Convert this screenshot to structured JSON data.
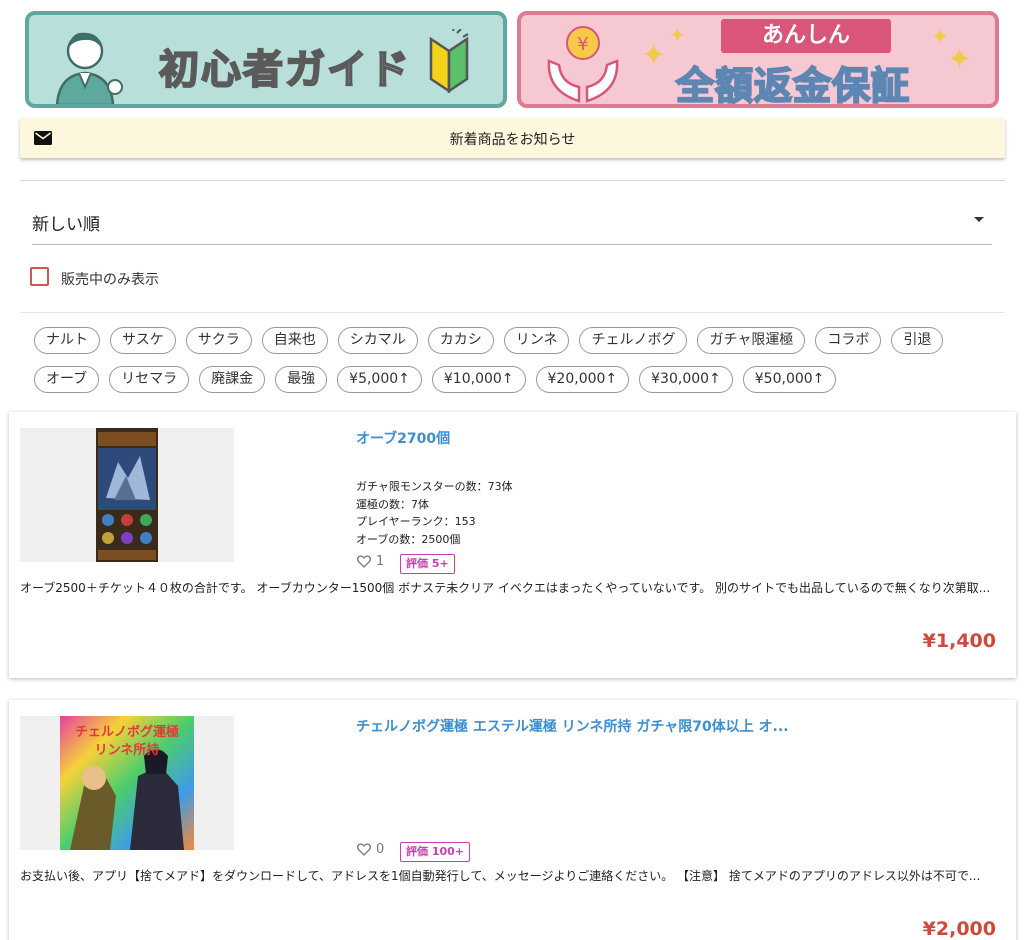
{
  "banners": {
    "guide": {
      "text": "初心者ガイド",
      "bg": "#b9dfdb",
      "border": "#5fa89d"
    },
    "refund": {
      "ribbon": "あんしん",
      "text": "全額返金保証",
      "bg": "#f6c9d2",
      "border": "#e07a93"
    }
  },
  "notify": {
    "icon": "mail-icon",
    "label": "新着商品をお知らせ"
  },
  "sort": {
    "selected": "新しい順"
  },
  "filter": {
    "on_sale_only_label": "販売中のみ表示",
    "checked": false
  },
  "tags": {
    "row1": [
      "ナルト",
      "サスケ",
      "サクラ",
      "自来也",
      "シカマル",
      "カカシ",
      "リンネ",
      "チェルノボグ",
      "ガチャ限運極",
      "コラボ",
      "引退"
    ],
    "row2": [
      "オーブ",
      "リセマラ",
      "廃課金",
      "最強",
      "¥5,000↑",
      "¥10,000↑",
      "¥20,000↑",
      "¥30,000↑",
      "¥50,000↑"
    ]
  },
  "products": [
    {
      "title": "オーブ2700個",
      "specs": [
        "ガチャ限モンスターの数：73体",
        "運極の数：7体",
        "プレイヤーランク：153",
        "オーブの数：2500個"
      ],
      "likes": "1",
      "rating": "評価 5+",
      "description": "オーブ2500＋チケット４０枚の合計です。 オーブカウンター1500個 ボナステ未クリア イベクエはまったくやっていないです。 別のサイトでも出品しているので無くなり次第取...",
      "price": "¥1,400"
    },
    {
      "title": "チェルノボグ運極 エステル運極 リンネ所持 ガチャ限70体以上 オ...",
      "image_text": [
        "チェルノボグ運極",
        "リンネ所持"
      ],
      "likes": "0",
      "rating": "評価 100+",
      "description": "お支払い後、アプリ【捨てメアド】をダウンロードして、アドレスを1個自動発行して、メッセージよりご連絡ください。 【注意】 捨てメアドのアプリのアドレス以外は不可で...",
      "price": "¥2,000"
    }
  ],
  "colors": {
    "accent_link": "#3d8fd1",
    "price": "#d0483a",
    "rating": "#c83fb2"
  }
}
